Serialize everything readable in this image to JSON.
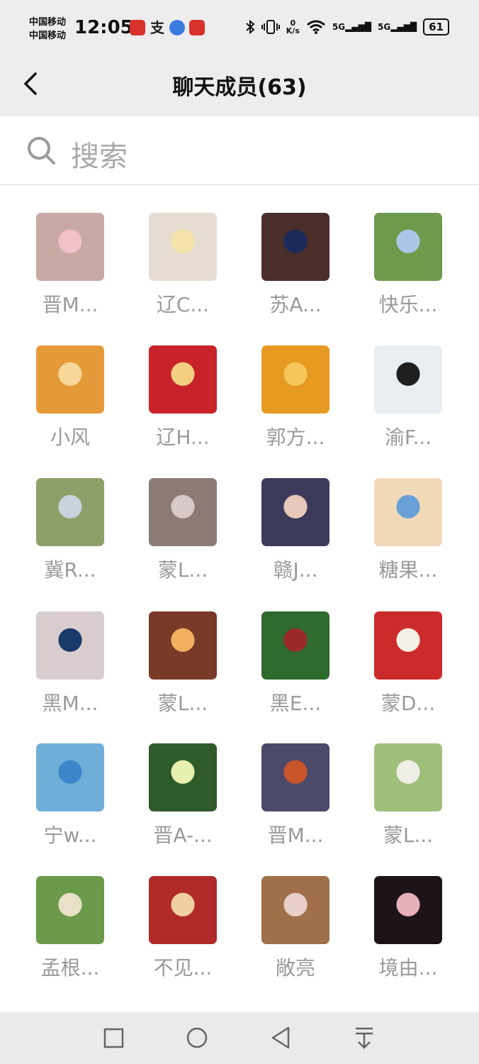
{
  "status_bar": {
    "carrier_1": "中国移动",
    "carrier_2": "中国移动",
    "time": "12:05",
    "net_speed_value": "0",
    "net_speed_unit": "K/s",
    "signal_1": "5G",
    "signal_2": "5G",
    "battery": "61",
    "app_icons": [
      "weather-app-icon",
      "alipay-icon",
      "browser-icon",
      "bank-app-icon"
    ]
  },
  "header": {
    "title": "聊天成员(63)"
  },
  "search": {
    "placeholder": "搜索"
  },
  "members": [
    {
      "name": "晋M..."
    },
    {
      "name": "辽C..."
    },
    {
      "name": "苏A..."
    },
    {
      "name": "快乐..."
    },
    {
      "name": "小风"
    },
    {
      "name": "辽H..."
    },
    {
      "name": "郭方..."
    },
    {
      "name": "渝F..."
    },
    {
      "name": "冀R..."
    },
    {
      "name": "蒙L..."
    },
    {
      "name": "赣J..."
    },
    {
      "name": "糖果..."
    },
    {
      "name": "黑M..."
    },
    {
      "name": "蒙L..."
    },
    {
      "name": "黑E..."
    },
    {
      "name": "蒙D..."
    },
    {
      "name": "宁w..."
    },
    {
      "name": "晋A-..."
    },
    {
      "name": "晋M..."
    },
    {
      "name": "蒙L..."
    },
    {
      "name": "孟根..."
    },
    {
      "name": "不见..."
    },
    {
      "name": "敞亮"
    },
    {
      "name": "境由..."
    }
  ],
  "avatar_colors": [
    "#c9a9a4",
    "#e6dccf",
    "#4a2e2a",
    "#6f9a4c",
    "#e59a3a",
    "#c8232a",
    "#e69a22",
    "#e8eef2",
    "#8ea06a",
    "#8c7b74",
    "#3c3a5a",
    "#f2d9b8",
    "#d9cdd0",
    "#7a3a28",
    "#2f6a2f",
    "#cc2b2b",
    "#6faed8",
    "#2f5a2a",
    "#4b4a6a",
    "#9fbf7a",
    "#6a9a4a",
    "#b02a2a",
    "#a0704a",
    "#1c1418"
  ],
  "avatar_accents": [
    "#f2c0c8",
    "#f5e2a8",
    "#1b2a5a",
    "#aac7e8",
    "#f7d79a",
    "#f2d080",
    "#f7c65a",
    "#1f1f1f",
    "#c8d3dd",
    "#d8c8c8",
    "#e8c8b8",
    "#6aa0d8",
    "#1a3a6a",
    "#f2b060",
    "#9a2a2a",
    "#f5f0ea",
    "#3a86c8",
    "#e8f0b0",
    "#c8542a",
    "#f0efe6",
    "#e8e0c8",
    "#f0d0a0",
    "#e8d0c8",
    "#e8b0b8"
  ]
}
